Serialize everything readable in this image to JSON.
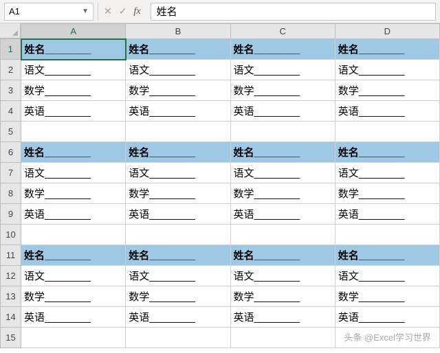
{
  "nameBox": {
    "value": "A1"
  },
  "formulaBar": {
    "cancel": "✕",
    "enter": "✓",
    "fx": "fx",
    "value": "姓名"
  },
  "columns": [
    "A",
    "B",
    "C",
    "D"
  ],
  "rows": [
    "1",
    "2",
    "3",
    "4",
    "5",
    "6",
    "7",
    "8",
    "9",
    "10",
    "11",
    "12",
    "13",
    "14",
    "15"
  ],
  "card": {
    "name": "姓名________",
    "lang": "语文________",
    "math": "数学________",
    "eng": "英语________"
  },
  "grid": [
    {
      "type": "header"
    },
    {
      "type": "data",
      "key": "lang"
    },
    {
      "type": "data",
      "key": "math"
    },
    {
      "type": "data",
      "key": "eng"
    },
    {
      "type": "blank"
    },
    {
      "type": "header"
    },
    {
      "type": "data",
      "key": "lang"
    },
    {
      "type": "data",
      "key": "math"
    },
    {
      "type": "data",
      "key": "eng"
    },
    {
      "type": "blank"
    },
    {
      "type": "header"
    },
    {
      "type": "data",
      "key": "lang"
    },
    {
      "type": "data",
      "key": "math"
    },
    {
      "type": "data",
      "key": "eng"
    },
    {
      "type": "blank"
    }
  ],
  "watermark": "头条 @Excel学习世界"
}
